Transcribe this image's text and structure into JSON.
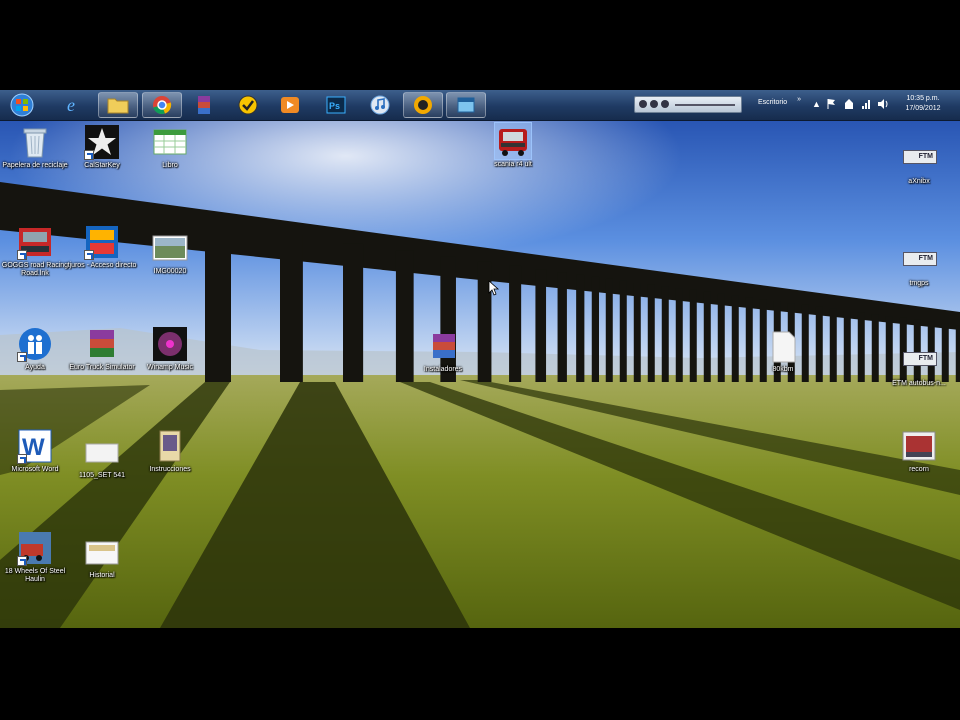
{
  "taskbar": {
    "toolbar_label": "Escritorio",
    "toolbar_chevron": "»",
    "clock_time": "10:35 p.m.",
    "clock_date": "17/09/2012",
    "pinned": [
      {
        "name": "start-orb",
        "active": false
      },
      {
        "name": "internet-explorer",
        "active": false
      },
      {
        "name": "windows-explorer",
        "active": true
      },
      {
        "name": "google-chrome",
        "active": true
      },
      {
        "name": "winrar",
        "active": false
      },
      {
        "name": "norton",
        "active": false
      },
      {
        "name": "media-player",
        "active": false
      },
      {
        "name": "photoshop",
        "active": false
      },
      {
        "name": "itunes",
        "active": false
      },
      {
        "name": "winamp",
        "active": true
      },
      {
        "name": "generic-app",
        "active": true
      }
    ]
  },
  "desktop": {
    "icons": {
      "recycle": "Papelera de reciclaje",
      "star_app": "CalStarKey",
      "calc_app": "Libro",
      "truck_selected": "scania r4 ult",
      "ftm1": "aXnibx",
      "ftm2": "tmgps",
      "ftm3": "ETM autobus-n...",
      "game1": "GOGGS road Racing Road.lnk",
      "game2": "tjuros - Acceso directo",
      "photo": "IMG00020",
      "euro_truck": "Euro Truck Simulator",
      "winamp_file": "Winamp Music",
      "rar1": "Instaladores",
      "blank_file": "80kbm",
      "help_app": "Ayuda",
      "word": "Microsoft Word",
      "drive_file": "1105_SET 541",
      "book": "Instrucciones",
      "screen_file": "recorn",
      "hauling": "18 Wheels Of Steel Haulin",
      "history": "Historial"
    }
  },
  "colors": {
    "taskbar": "#1f3a63",
    "sky_top": "#1f4fb0",
    "grass": "#6f7f1a"
  }
}
